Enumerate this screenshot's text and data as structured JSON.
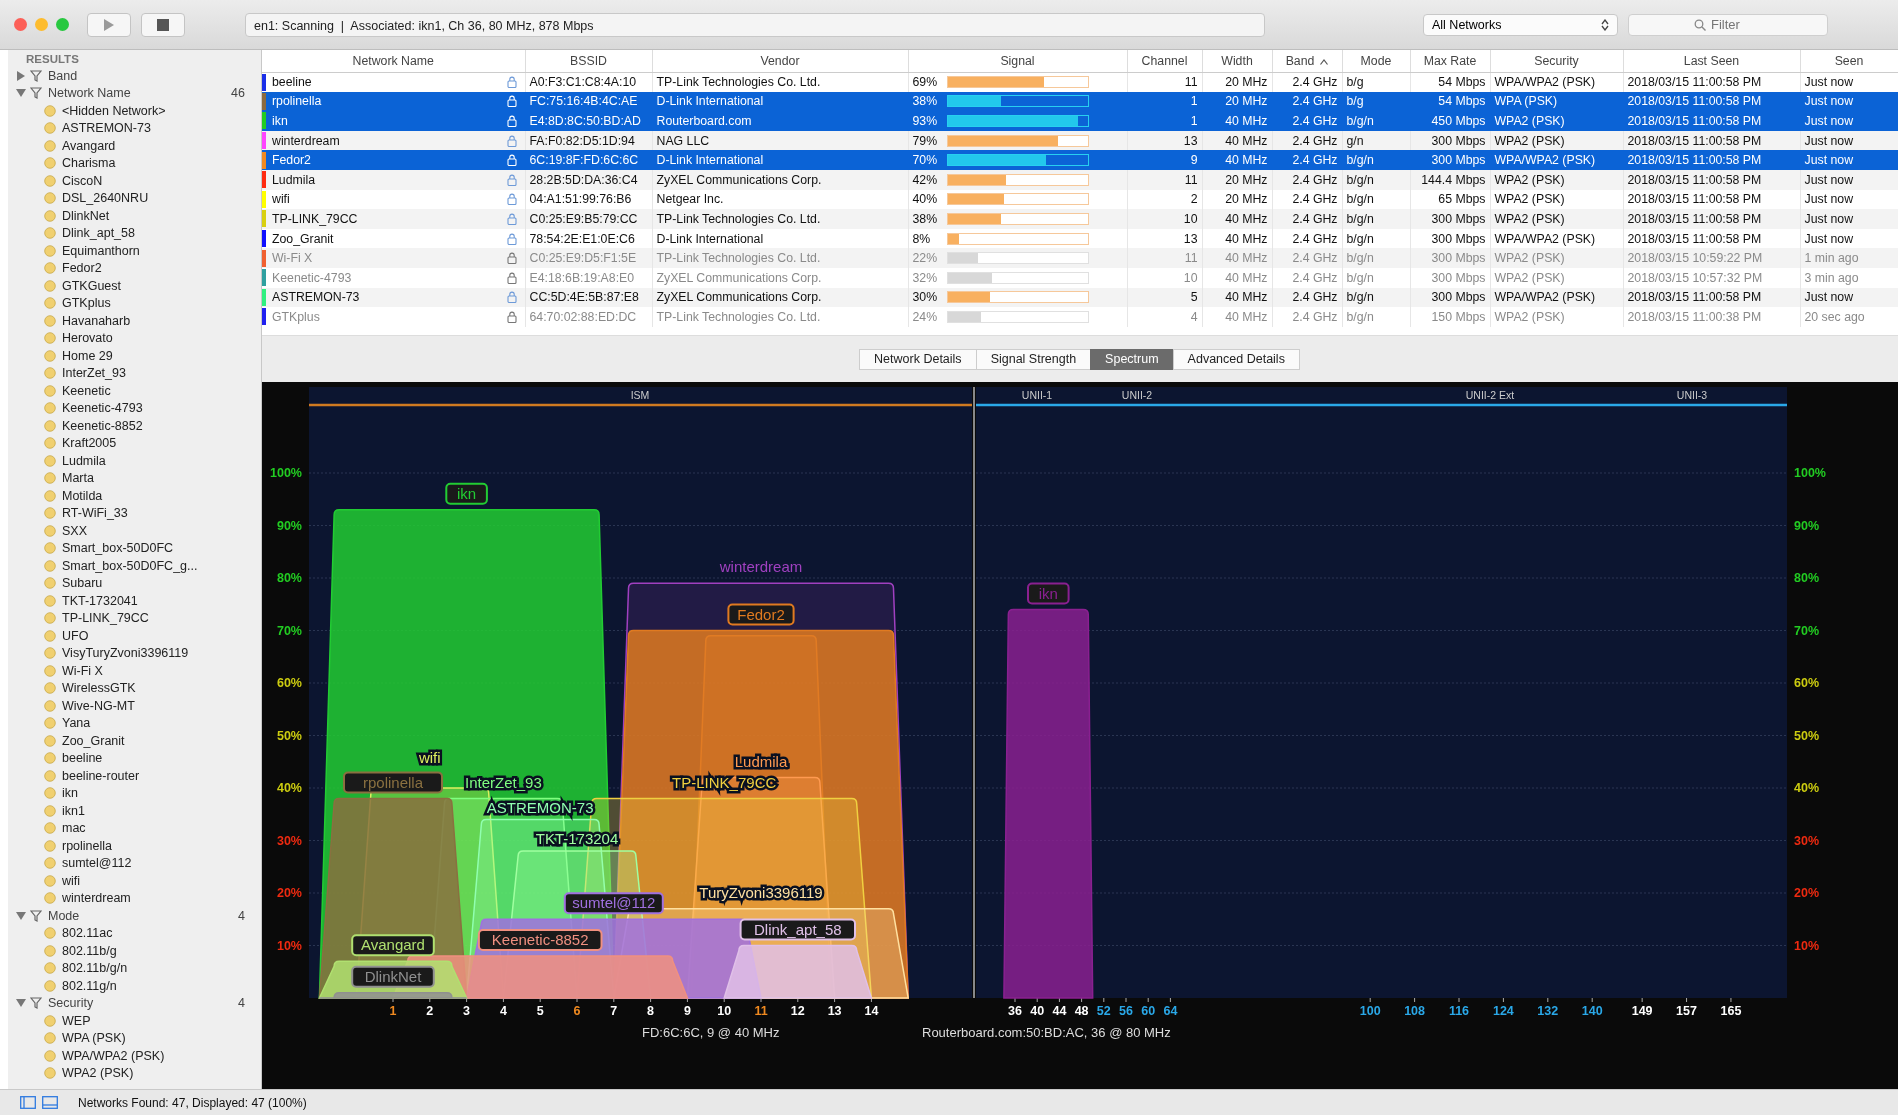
{
  "toolbar": {
    "status": "en1: Scanning  |  Associated: ikn1, Ch 36, 80 MHz, 878 Mbps",
    "filter_menu": "All Networks",
    "search": {
      "placeholder": "Filter"
    }
  },
  "sidebar": {
    "title": "RESULTS",
    "groups": [
      {
        "label": "Band",
        "expanded": false
      },
      {
        "label": "Network Name",
        "count": "46",
        "expanded": true,
        "children": [
          {
            "label": "<Hidden Network>"
          },
          {
            "label": "ASTREMON-73"
          },
          {
            "label": "Avangard"
          },
          {
            "label": "Charisma"
          },
          {
            "label": "CiscoN"
          },
          {
            "label": "DSL_2640NRU"
          },
          {
            "label": "DlinkNet"
          },
          {
            "label": "Dlink_apt_58"
          },
          {
            "label": "Equimanthorn"
          },
          {
            "label": "Fedor2"
          },
          {
            "label": "GTKGuest"
          },
          {
            "label": "GTKplus"
          },
          {
            "label": "Havanaharb"
          },
          {
            "label": "Herovato"
          },
          {
            "label": "Home 29"
          },
          {
            "label": "InterZet_93"
          },
          {
            "label": "Keenetic"
          },
          {
            "label": "Keenetic-4793"
          },
          {
            "label": "Keenetic-8852"
          },
          {
            "label": "Kraft2005"
          },
          {
            "label": "Ludmila"
          },
          {
            "label": "Marta"
          },
          {
            "label": "Motilda"
          },
          {
            "label": "RT-WiFi_33"
          },
          {
            "label": "SXX"
          },
          {
            "label": "Smart_box-50D0FC"
          },
          {
            "label": "Smart_box-50D0FC_g..."
          },
          {
            "label": "Subaru"
          },
          {
            "label": "TKT-1732041"
          },
          {
            "label": "TP-LINK_79CC"
          },
          {
            "label": "UFO"
          },
          {
            "label": "VisyTuryZvoni3396119"
          },
          {
            "label": "Wi-Fi X"
          },
          {
            "label": "WirelessGTK"
          },
          {
            "label": "Wive-NG-MT"
          },
          {
            "label": "Yana"
          },
          {
            "label": "Zoo_Granit"
          },
          {
            "label": "beeline"
          },
          {
            "label": "beeline-router"
          },
          {
            "label": "ikn"
          },
          {
            "label": "ikn1"
          },
          {
            "label": "mac"
          },
          {
            "label": "rpolinella"
          },
          {
            "label": "sumtel@112"
          },
          {
            "label": "wifi"
          },
          {
            "label": "winterdream"
          }
        ]
      },
      {
        "label": "Mode",
        "count": "4",
        "expanded": true,
        "children": [
          {
            "label": "802.11ac"
          },
          {
            "label": "802.11b/g"
          },
          {
            "label": "802.11b/g/n"
          },
          {
            "label": "802.11g/n"
          }
        ]
      },
      {
        "label": "Security",
        "count": "4",
        "expanded": true,
        "children": [
          {
            "label": "WEP"
          },
          {
            "label": "WPA (PSK)"
          },
          {
            "label": "WPA/WPA2 (PSK)"
          },
          {
            "label": "WPA2 (PSK)"
          }
        ]
      }
    ]
  },
  "table": {
    "columns": [
      {
        "label": "Network Name"
      },
      {
        "label": "BSSID"
      },
      {
        "label": "Vendor"
      },
      {
        "label": "Signal"
      },
      {
        "label": "Channel"
      },
      {
        "label": "Width"
      },
      {
        "label": "Band",
        "sorted": true
      },
      {
        "label": "Mode"
      },
      {
        "label": "Max Rate"
      },
      {
        "label": "Security"
      },
      {
        "label": "Last Seen"
      },
      {
        "label": "Seen"
      }
    ],
    "rows": [
      {
        "color": "#1a2ee8",
        "name": "beeline",
        "bssid": "A0:F3:C1:C8:4A:10",
        "vendor": "TP-Link Technologies Co. Ltd.",
        "signal": "69%",
        "level": 0.69,
        "channel": "11",
        "width": "20 MHz",
        "band": "2.4 GHz",
        "mode": "b/g",
        "max_rate": "54 Mbps",
        "security": "WPA/WPA2 (PSK)",
        "last_seen": "2018/03/15 11:00:58 PM",
        "seen": "Just now",
        "selected": false,
        "stale": false
      },
      {
        "color": "#8a6a40",
        "name": "rpolinella",
        "bssid": "FC:75:16:4B:4C:AE",
        "vendor": "D-Link International",
        "signal": "38%",
        "level": 0.38,
        "channel": "1",
        "width": "20 MHz",
        "band": "2.4 GHz",
        "mode": "b/g",
        "max_rate": "54 Mbps",
        "security": "WPA (PSK)",
        "last_seen": "2018/03/15 11:00:58 PM",
        "seen": "Just now",
        "selected": true,
        "stale": false
      },
      {
        "color": "#22cc22",
        "name": "ikn",
        "bssid": "E4:8D:8C:50:BD:AD",
        "vendor": "Routerboard.com",
        "signal": "93%",
        "level": 0.93,
        "channel": "1",
        "width": "40 MHz",
        "band": "2.4 GHz",
        "mode": "b/g/n",
        "max_rate": "450 Mbps",
        "security": "WPA2 (PSK)",
        "last_seen": "2018/03/15 11:00:58 PM",
        "seen": "Just now",
        "selected": true,
        "stale": false
      },
      {
        "color": "#ff44ff",
        "name": "winterdream",
        "bssid": "FA:F0:82:D5:1D:94",
        "vendor": "NAG LLC",
        "signal": "79%",
        "level": 0.79,
        "channel": "13",
        "width": "40 MHz",
        "band": "2.4 GHz",
        "mode": "g/n",
        "max_rate": "300 Mbps",
        "security": "WPA2 (PSK)",
        "last_seen": "2018/03/15 11:00:58 PM",
        "seen": "Just now",
        "selected": false,
        "stale": false
      },
      {
        "color": "#f08a20",
        "name": "Fedor2",
        "bssid": "6C:19:8F:FD:6C:6C",
        "vendor": "D-Link International",
        "signal": "70%",
        "level": 0.7,
        "channel": "9",
        "width": "40 MHz",
        "band": "2.4 GHz",
        "mode": "b/g/n",
        "max_rate": "300 Mbps",
        "security": "WPA/WPA2 (PSK)",
        "last_seen": "2018/03/15 11:00:58 PM",
        "seen": "Just now",
        "selected": true,
        "stale": false
      },
      {
        "color": "#ff2a10",
        "name": "Ludmila",
        "bssid": "28:2B:5D:DA:36:C4",
        "vendor": "ZyXEL Communications Corp.",
        "signal": "42%",
        "level": 0.42,
        "channel": "11",
        "width": "20 MHz",
        "band": "2.4 GHz",
        "mode": "b/g/n",
        "max_rate": "144.4 Mbps",
        "security": "WPA2 (PSK)",
        "last_seen": "2018/03/15 11:00:58 PM",
        "seen": "Just now",
        "selected": false,
        "stale": false
      },
      {
        "color": "#ffff00",
        "name": "wifi",
        "bssid": "04:A1:51:99:76:B6",
        "vendor": "Netgear Inc.",
        "signal": "40%",
        "level": 0.4,
        "channel": "2",
        "width": "20 MHz",
        "band": "2.4 GHz",
        "mode": "b/g/n",
        "max_rate": "65 Mbps",
        "security": "WPA2 (PSK)",
        "last_seen": "2018/03/15 11:00:58 PM",
        "seen": "Just now",
        "selected": false,
        "stale": false
      },
      {
        "color": "#d8d010",
        "name": "TP-LINK_79CC",
        "bssid": "C0:25:E9:B5:79:CC",
        "vendor": "TP-Link Technologies Co. Ltd.",
        "signal": "38%",
        "level": 0.38,
        "channel": "10",
        "width": "40 MHz",
        "band": "2.4 GHz",
        "mode": "b/g/n",
        "max_rate": "300 Mbps",
        "security": "WPA2 (PSK)",
        "last_seen": "2018/03/15 11:00:58 PM",
        "seen": "Just now",
        "selected": false,
        "stale": false
      },
      {
        "color": "#1010ff",
        "name": "Zoo_Granit",
        "bssid": "78:54:2E:E1:0E:C6",
        "vendor": "D-Link International",
        "signal": "8%",
        "level": 0.08,
        "channel": "13",
        "width": "40 MHz",
        "band": "2.4 GHz",
        "mode": "b/g/n",
        "max_rate": "300 Mbps",
        "security": "WPA/WPA2 (PSK)",
        "last_seen": "2018/03/15 11:00:58 PM",
        "seen": "Just now",
        "selected": false,
        "stale": false
      },
      {
        "color": "#f06030",
        "name": "Wi-Fi X",
        "bssid": "C0:25:E9:D5:F1:5E",
        "vendor": "TP-Link Technologies Co. Ltd.",
        "signal": "22%",
        "level": 0.22,
        "channel": "11",
        "width": "40 MHz",
        "band": "2.4 GHz",
        "mode": "b/g/n",
        "max_rate": "300 Mbps",
        "security": "WPA2 (PSK)",
        "last_seen": "2018/03/15 10:59:22 PM",
        "seen": "1 min ago",
        "selected": false,
        "stale": true
      },
      {
        "color": "#30a0a0",
        "name": "Keenetic-4793",
        "bssid": "E4:18:6B:19:A8:E0",
        "vendor": "ZyXEL Communications Corp.",
        "signal": "32%",
        "level": 0.32,
        "channel": "10",
        "width": "40 MHz",
        "band": "2.4 GHz",
        "mode": "b/g/n",
        "max_rate": "300 Mbps",
        "security": "WPA2 (PSK)",
        "last_seen": "2018/03/15 10:57:32 PM",
        "seen": "3 min ago",
        "selected": false,
        "stale": true
      },
      {
        "color": "#30f080",
        "name": "ASTREMON-73",
        "bssid": "CC:5D:4E:5B:87:E8",
        "vendor": "ZyXEL Communications Corp.",
        "signal": "30%",
        "level": 0.3,
        "channel": "5",
        "width": "40 MHz",
        "band": "2.4 GHz",
        "mode": "b/g/n",
        "max_rate": "300 Mbps",
        "security": "WPA/WPA2 (PSK)",
        "last_seen": "2018/03/15 11:00:58 PM",
        "seen": "Just now",
        "selected": false,
        "stale": false
      },
      {
        "color": "#2020f0",
        "name": "GTKplus",
        "bssid": "64:70:02:88:ED:DC",
        "vendor": "TP-Link Technologies Co. Ltd.",
        "signal": "24%",
        "level": 0.24,
        "channel": "4",
        "width": "40 MHz",
        "band": "2.4 GHz",
        "mode": "b/g/n",
        "max_rate": "150 Mbps",
        "security": "WPA2 (PSK)",
        "last_seen": "2018/03/15 11:00:38 PM",
        "seen": "20 sec ago",
        "selected": false,
        "stale": true
      }
    ]
  },
  "tabs": [
    {
      "label": "Network Details",
      "selected": false
    },
    {
      "label": "Signal Strength",
      "selected": false
    },
    {
      "label": "Spectrum",
      "selected": true
    },
    {
      "label": "Advanced Details",
      "selected": false
    }
  ],
  "spectrum": {
    "bands": [
      {
        "label": "ISM"
      },
      {
        "label": "UNII-1"
      },
      {
        "label": "UNII-2"
      },
      {
        "label": "UNII-2 Ext"
      },
      {
        "label": "UNII-3"
      }
    ],
    "y_ticks_left": [
      {
        "label": "100%",
        "color": "#22cc22"
      },
      {
        "label": "90%",
        "color": "#22cc22"
      },
      {
        "label": "80%",
        "color": "#22cc22"
      },
      {
        "label": "70%",
        "color": "#22cc22"
      },
      {
        "label": "60%",
        "color": "#cccc10"
      },
      {
        "label": "50%",
        "color": "#cccc10"
      },
      {
        "label": "40%",
        "color": "#cccc10"
      },
      {
        "label": "30%",
        "color": "#ee2a10"
      },
      {
        "label": "20%",
        "color": "#ee2a10"
      },
      {
        "label": "10%",
        "color": "#ee2a10"
      }
    ],
    "y_ticks_right": [
      {
        "label": "100%",
        "color": "#22cc22"
      },
      {
        "label": "90%",
        "color": "#22cc22"
      },
      {
        "label": "80%",
        "color": "#22cc22"
      },
      {
        "label": "70%",
        "color": "#22cc22"
      },
      {
        "label": "60%",
        "color": "#cccc10"
      },
      {
        "label": "50%",
        "color": "#cccc10"
      },
      {
        "label": "40%",
        "color": "#cccc10"
      },
      {
        "label": "30%",
        "color": "#ee2a10"
      },
      {
        "label": "20%",
        "color": "#ee2a10"
      },
      {
        "label": "10%",
        "color": "#ee2a10"
      }
    ],
    "x_ticks": [
      {
        "label": "1",
        "color": "#f08a20"
      },
      {
        "label": "2",
        "color": "#ffffff"
      },
      {
        "label": "3",
        "color": "#ffffff"
      },
      {
        "label": "4",
        "color": "#ffffff"
      },
      {
        "label": "5",
        "color": "#ffffff"
      },
      {
        "label": "6",
        "color": "#f08a20"
      },
      {
        "label": "7",
        "color": "#ffffff"
      },
      {
        "label": "8",
        "color": "#ffffff"
      },
      {
        "label": "9",
        "color": "#ffffff"
      },
      {
        "label": "10",
        "color": "#ffffff"
      },
      {
        "label": "11",
        "color": "#f08a20"
      },
      {
        "label": "12",
        "color": "#ffffff"
      },
      {
        "label": "13",
        "color": "#ffffff"
      },
      {
        "label": "14",
        "color": "#ffffff"
      },
      {
        "label": "36",
        "color": "#ffffff"
      },
      {
        "label": "40",
        "color": "#ffffff"
      },
      {
        "label": "44",
        "color": "#ffffff"
      },
      {
        "label": "48",
        "color": "#ffffff"
      },
      {
        "label": "52",
        "color": "#2aa8e8"
      },
      {
        "label": "56",
        "color": "#2aa8e8"
      },
      {
        "label": "60",
        "color": "#2aa8e8"
      },
      {
        "label": "64",
        "color": "#2aa8e8"
      },
      {
        "label": "100",
        "color": "#2aa8e8"
      },
      {
        "label": "108",
        "color": "#2aa8e8"
      },
      {
        "label": "116",
        "color": "#2aa8e8"
      },
      {
        "label": "124",
        "color": "#2aa8e8"
      },
      {
        "label": "132",
        "color": "#2aa8e8"
      },
      {
        "label": "140",
        "color": "#2aa8e8"
      },
      {
        "label": "149",
        "color": "#ffffff"
      },
      {
        "label": "157",
        "color": "#ffffff"
      },
      {
        "label": "165",
        "color": "#ffffff"
      }
    ],
    "signals": [
      {
        "color": "#22cc33",
        "kind": "boxed",
        "label": "ikn"
      },
      {
        "color": "#a040c0",
        "kind": "outline",
        "label": "winterdream"
      },
      {
        "color": "#e07a20",
        "kind": "boxed",
        "label": "Fedor2"
      },
      {
        "color": "#ff9a50",
        "kind": "faint",
        "label": "Ludmila"
      },
      {
        "color": "#f0d040",
        "kind": "faint",
        "label": "TP-LINK_79CC"
      },
      {
        "color": "#e0f060",
        "kind": "faint",
        "label": "wifi"
      },
      {
        "color": "#80ff80",
        "kind": "faint",
        "label": "InterZet_93"
      },
      {
        "color": "#90ffb0",
        "kind": "faint",
        "label": "ASTREMON-73"
      },
      {
        "color": "#a0ffa0",
        "kind": "faint",
        "label": "TKT-173204"
      },
      {
        "color": "#ffe0a0",
        "kind": "faint",
        "label": "TuryZvoni3396119"
      },
      {
        "color": "#8a7040",
        "kind": "boxed",
        "label": "rpolinella"
      },
      {
        "color": "#a070e0",
        "kind": "boxed",
        "label": "sumtel@112"
      },
      {
        "color": "#f09080",
        "kind": "boxed",
        "label": "Keenetic-8852"
      },
      {
        "color": "#e0c0e8",
        "kind": "boxed",
        "label": "Dlink_apt_58"
      },
      {
        "color": "#b0e070",
        "kind": "boxed",
        "label": "Avangard"
      },
      {
        "color": "#909090",
        "kind": "boxed",
        "label": "DlinkNet"
      },
      {
        "color": "#8a2090",
        "kind": "boxed",
        "label": "ikn"
      }
    ],
    "captions": [
      {
        "text": "FD:6C:6C, 9 @ 40 MHz"
      },
      {
        "text": "Routerboard.com:50:BD:AC, 36 @ 80 MHz"
      }
    ]
  },
  "status_bar": {
    "text": "Networks Found: 47, Displayed: 47 (100%)"
  }
}
